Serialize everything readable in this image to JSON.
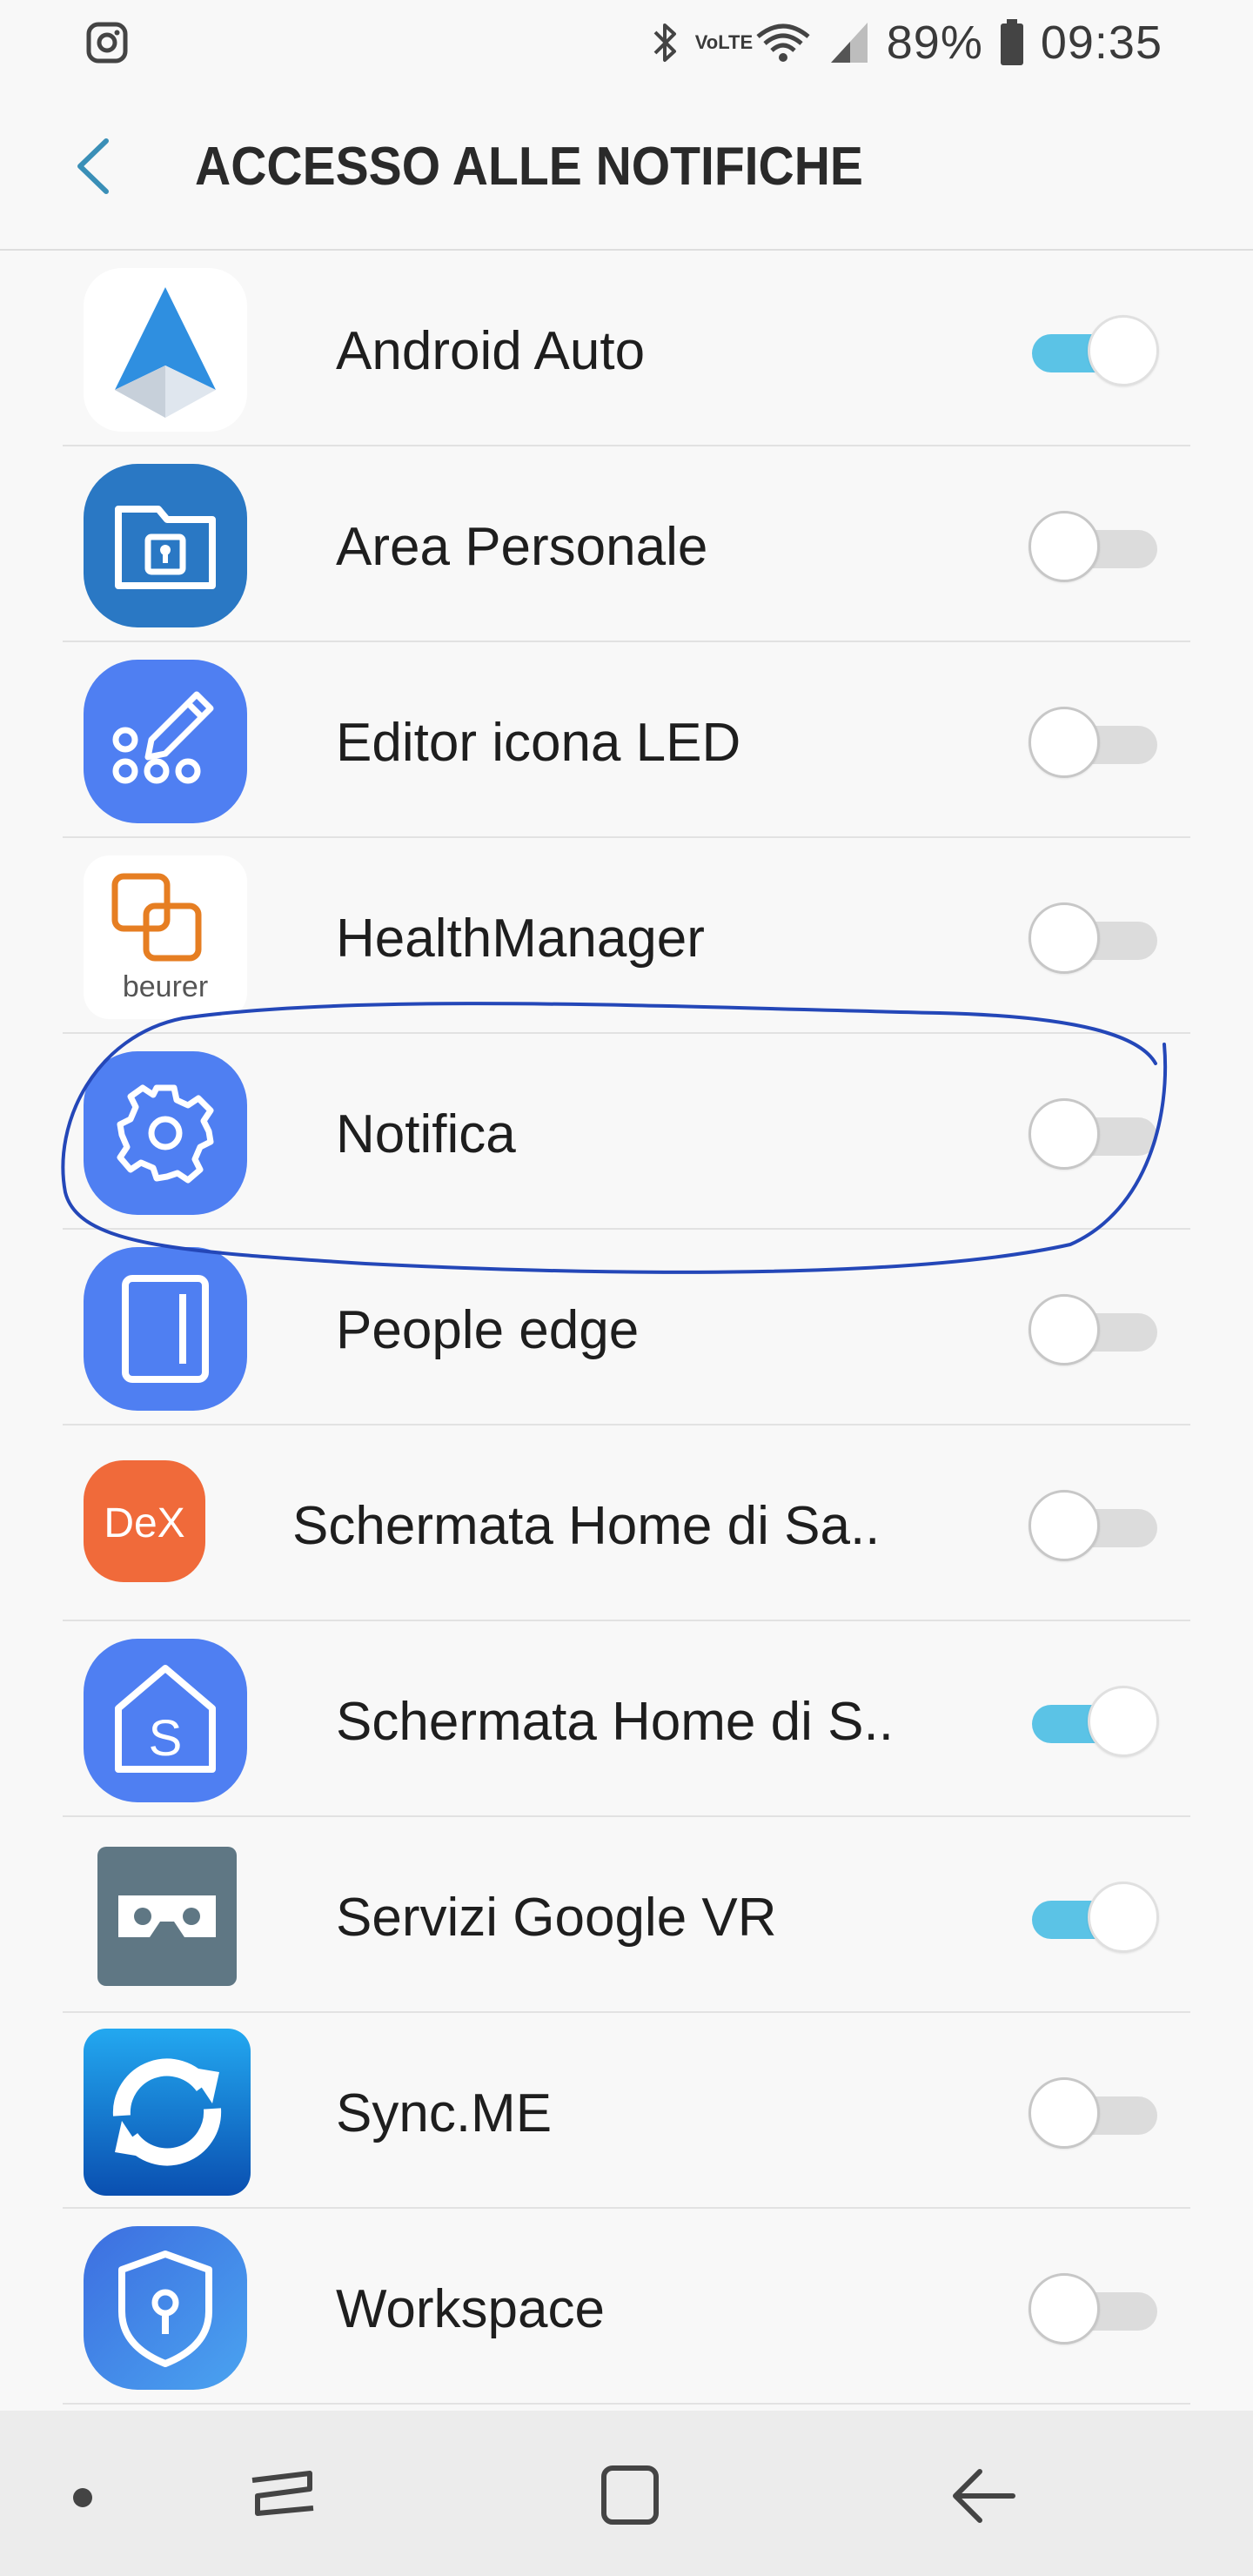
{
  "status_bar": {
    "battery": "89%",
    "time": "09:35",
    "network": "VoLTE",
    "icons": [
      "instagram-icon",
      "bluetooth-icon",
      "wifi-icon",
      "signal-icon",
      "battery-icon"
    ]
  },
  "header": {
    "title": "ACCESSO ALLE NOTIFICHE",
    "back_icon": "chevron-left-icon"
  },
  "apps": [
    {
      "label": "Android Auto",
      "enabled": true,
      "icon": "android-auto-icon"
    },
    {
      "label": "Area Personale",
      "enabled": false,
      "icon": "secure-folder-icon"
    },
    {
      "label": "Editor icona LED",
      "enabled": false,
      "icon": "led-editor-icon"
    },
    {
      "label": "HealthManager",
      "enabled": false,
      "icon": "beurer-icon",
      "icon_text": "beurer"
    },
    {
      "label": "Notifica",
      "enabled": false,
      "icon": "gear-icon"
    },
    {
      "label": "People edge",
      "enabled": false,
      "icon": "people-edge-icon"
    },
    {
      "label": "Schermata Home di Sa..",
      "enabled": false,
      "icon": "dex-icon",
      "icon_text": "DeX"
    },
    {
      "label": "Schermata Home di S..",
      "enabled": true,
      "icon": "samsung-home-icon"
    },
    {
      "label": "Servizi Google VR",
      "enabled": true,
      "icon": "google-vr-icon"
    },
    {
      "label": "Sync.ME",
      "enabled": false,
      "icon": "sync-icon"
    },
    {
      "label": "Workspace",
      "enabled": false,
      "icon": "workspace-shield-icon"
    }
  ],
  "nav_bar": {
    "items": [
      "dot-icon",
      "recent-apps-icon",
      "home-icon",
      "back-icon"
    ]
  },
  "colors": {
    "toggle_on": "#5bc3e6",
    "toggle_off": "#dcdcdc",
    "accent_back": "#3a8fb7",
    "annotation": "#2447b8",
    "samsung_blue": "#4f7ff2"
  }
}
